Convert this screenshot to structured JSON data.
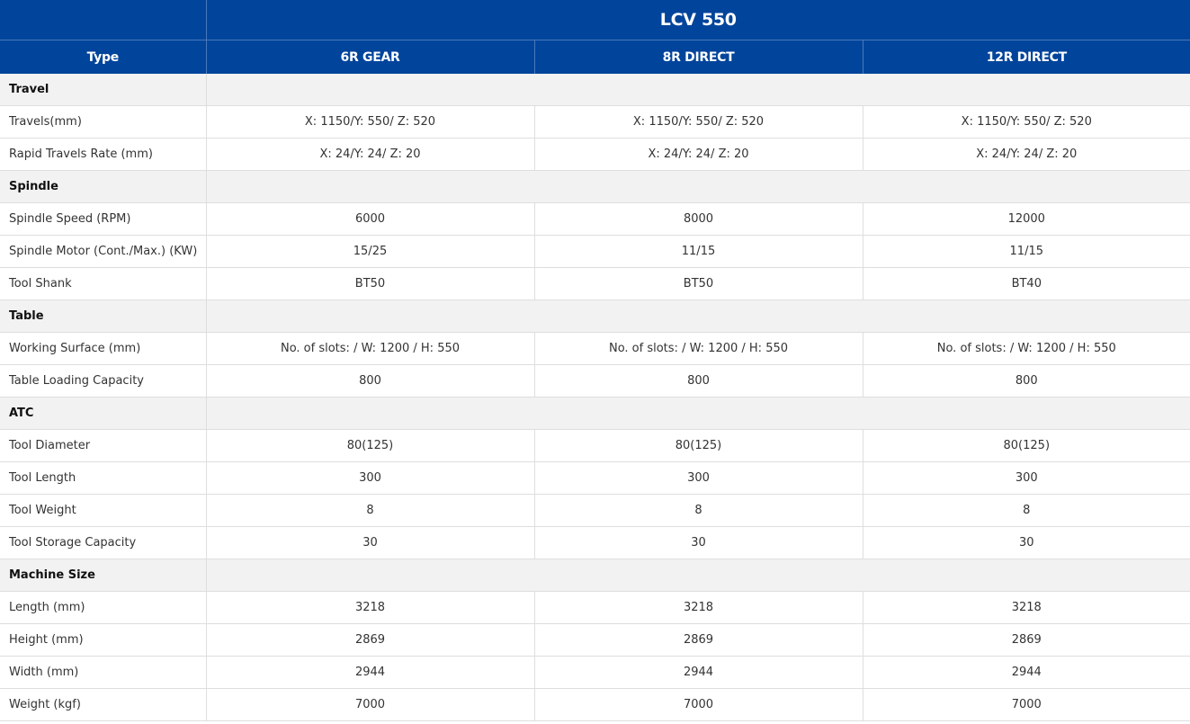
{
  "model": "LCV 550",
  "columns": [
    "Type",
    "6R GEAR",
    "8R DIRECT",
    "12R DIRECT"
  ],
  "rows": [
    {
      "type": "section",
      "label": "Travel"
    },
    {
      "type": "data",
      "label": "Travels(mm)",
      "values": [
        "X: 1150/Y: 550/ Z: 520",
        "X: 1150/Y: 550/ Z: 520",
        "X: 1150/Y: 550/ Z: 520"
      ]
    },
    {
      "type": "data",
      "label": "Rapid Travels Rate (mm)",
      "values": [
        "X: 24/Y: 24/ Z: 20",
        "X: 24/Y: 24/ Z: 20",
        "X: 24/Y: 24/ Z: 20"
      ]
    },
    {
      "type": "section",
      "label": "Spindle"
    },
    {
      "type": "data",
      "label": "Spindle Speed (RPM)",
      "values": [
        "6000",
        "8000",
        "12000"
      ]
    },
    {
      "type": "data",
      "label": "Spindle Motor (Cont./Max.) (KW)",
      "values": [
        "15/25",
        "11/15",
        "11/15"
      ]
    },
    {
      "type": "data",
      "label": "Tool Shank",
      "values": [
        "BT50",
        "BT50",
        "BT40"
      ]
    },
    {
      "type": "section",
      "label": "Table"
    },
    {
      "type": "data",
      "label": "Working Surface (mm)",
      "values": [
        "No. of slots: / W: 1200 / H: 550",
        "No. of slots: / W: 1200 / H: 550",
        "No. of slots: / W: 1200 / H: 550"
      ]
    },
    {
      "type": "data",
      "label": "Table Loading Capacity",
      "values": [
        "800",
        "800",
        "800"
      ]
    },
    {
      "type": "section",
      "label": "ATC"
    },
    {
      "type": "data",
      "label": "Tool Diameter",
      "values": [
        "80(125)",
        "80(125)",
        "80(125)"
      ]
    },
    {
      "type": "data",
      "label": "Tool Length",
      "values": [
        "300",
        "300",
        "300"
      ]
    },
    {
      "type": "data",
      "label": "Tool Weight",
      "values": [
        "8",
        "8",
        "8"
      ]
    },
    {
      "type": "data",
      "label": "Tool Storage Capacity",
      "values": [
        "30",
        "30",
        "30"
      ]
    },
    {
      "type": "section",
      "label": "Machine Size"
    },
    {
      "type": "data",
      "label": "Length (mm)",
      "values": [
        "3218",
        "3218",
        "3218"
      ]
    },
    {
      "type": "data",
      "label": "Height (mm)",
      "values": [
        "2869",
        "2869",
        "2869"
      ]
    },
    {
      "type": "data",
      "label": "Width (mm)",
      "values": [
        "2944",
        "2944",
        "2944"
      ]
    },
    {
      "type": "data",
      "label": "Weight (kgf)",
      "values": [
        "7000",
        "7000",
        "7000"
      ]
    }
  ]
}
